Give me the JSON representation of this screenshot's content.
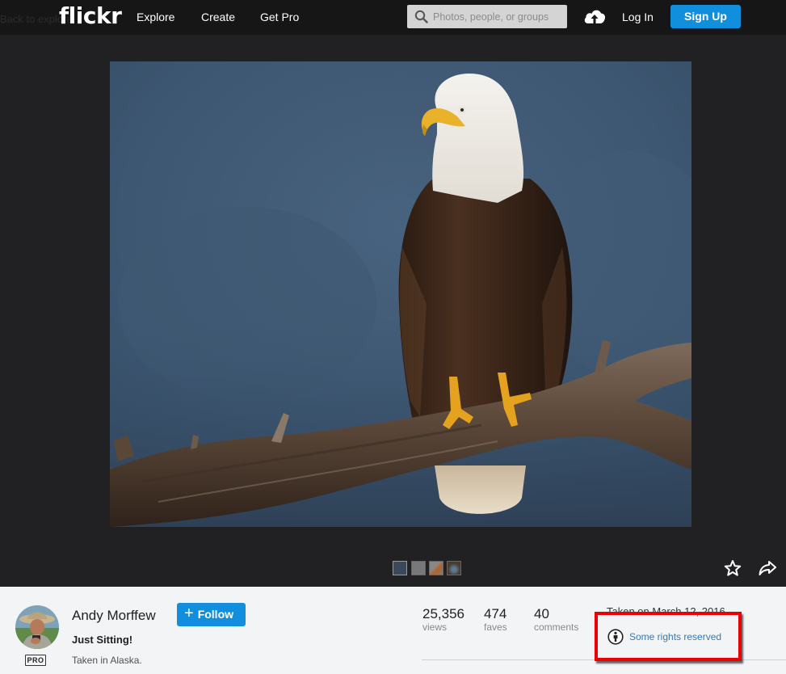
{
  "header": {
    "back_link": "Back to explore",
    "logo": "flickr",
    "nav": [
      {
        "label": "Explore"
      },
      {
        "label": "Create"
      },
      {
        "label": "Get Pro"
      }
    ],
    "search": {
      "placeholder": "Photos, people, or groups",
      "value": "",
      "icon": "search-icon"
    },
    "upload_icon": "cloud-upload-icon",
    "login_label": "Log In",
    "signup_label": "Sign Up"
  },
  "photo": {
    "alt": "Bald eagle perched on a weathered branch against a blue background",
    "thumbnails": [
      {
        "name": "eagle",
        "active": true
      },
      {
        "name": "grey-bird",
        "active": false
      },
      {
        "name": "robin",
        "active": false
      },
      {
        "name": "blue-bird",
        "active": false
      }
    ],
    "fave_icon": "star-outline-icon",
    "share_icon": "share-arrow-icon"
  },
  "author": {
    "name": "Andy Morffew",
    "badge": "PRO",
    "follow_label": "Follow",
    "follow_icon": "+"
  },
  "details": {
    "title": "Just Sitting!",
    "description": "Taken in Alaska.",
    "stats": [
      {
        "value": "25,356",
        "label": "views"
      },
      {
        "value": "474",
        "label": "faves"
      },
      {
        "value": "40",
        "label": "comments"
      }
    ],
    "taken_on": "Taken on March 12, 2016",
    "license": "Some rights reserved",
    "license_icon": "creative-commons-attribution-icon"
  },
  "colors": {
    "brand_blue": "#128fdc",
    "nav_bg": "#161617",
    "stage_bg": "#212124",
    "info_bg": "#f2f4f6",
    "link_blue": "#3a78b0",
    "highlight_red": "#ee0000"
  }
}
